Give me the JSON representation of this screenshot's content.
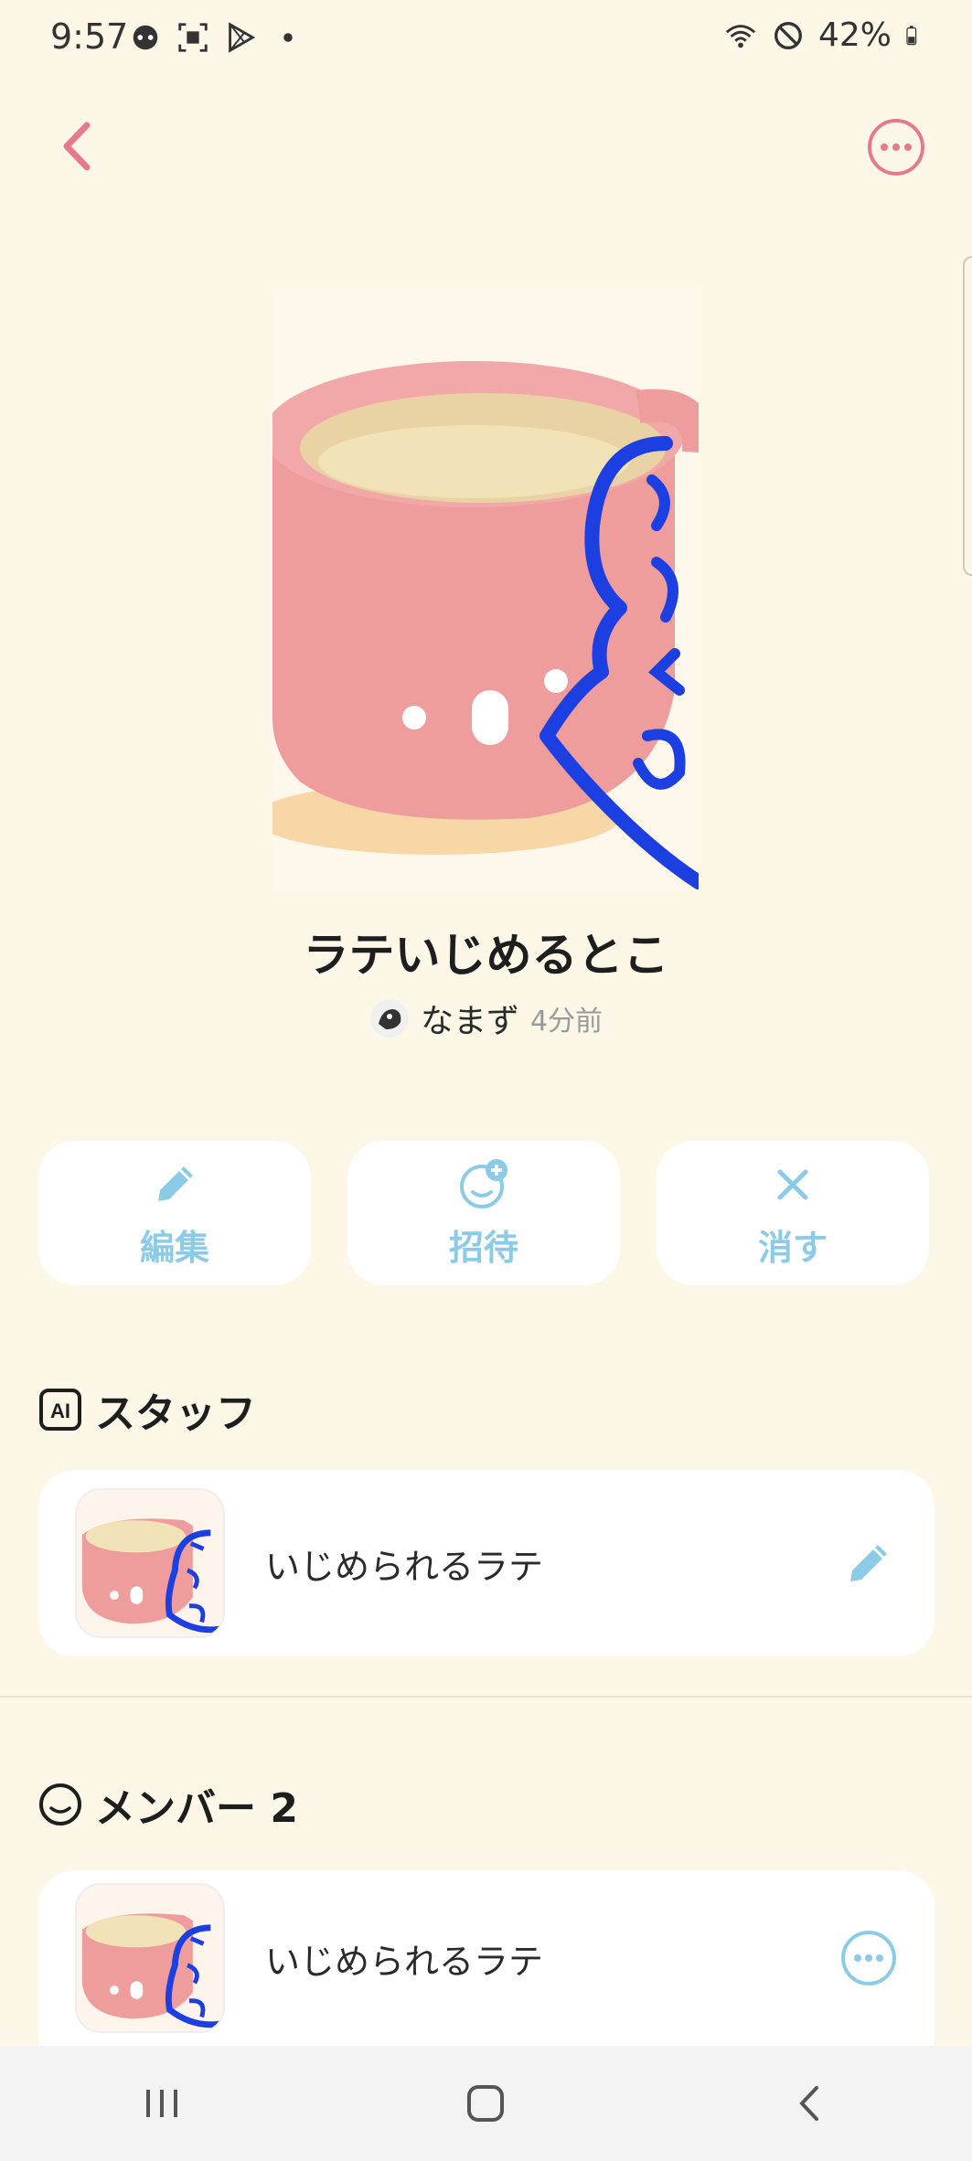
{
  "status_bar": {
    "time": "9:57",
    "battery": "42%",
    "icons_left": [
      "chat-bubble-icon",
      "screenshot-icon",
      "play-store-icon",
      "dot-icon"
    ],
    "icons_right": [
      "wifi-icon",
      "do-not-disturb-icon",
      "battery-icon"
    ]
  },
  "top_bar": {
    "back_icon": "chevron-left-icon",
    "more_icon": "more-circle-icon",
    "accent": "#E57A8C"
  },
  "chat": {
    "title": "ラテいじめるとこ",
    "owner_name": "なまず",
    "owner_time": "4分前"
  },
  "actions": [
    {
      "label": "編集",
      "icon": "pencil-icon"
    },
    {
      "label": "招待",
      "icon": "add-person-icon"
    },
    {
      "label": "消す",
      "icon": "close-icon"
    }
  ],
  "staff_section": {
    "icon": "ai-badge-icon",
    "title": "スタッフ",
    "items": [
      {
        "name": "いじめられるラテ",
        "action_icon": "pencil-icon"
      }
    ]
  },
  "members_section": {
    "icon": "smiley-icon",
    "title": "メンバー 2",
    "items": [
      {
        "name": "いじめられるラテ",
        "action_icon": "more-circle-icon"
      }
    ]
  },
  "colors": {
    "background": "#FDF7E8",
    "accent_blue": "#8CCBE8",
    "accent_pink": "#E57A8C"
  },
  "nav_bar": {
    "buttons": [
      "recents-icon",
      "home-icon",
      "back-icon"
    ]
  }
}
